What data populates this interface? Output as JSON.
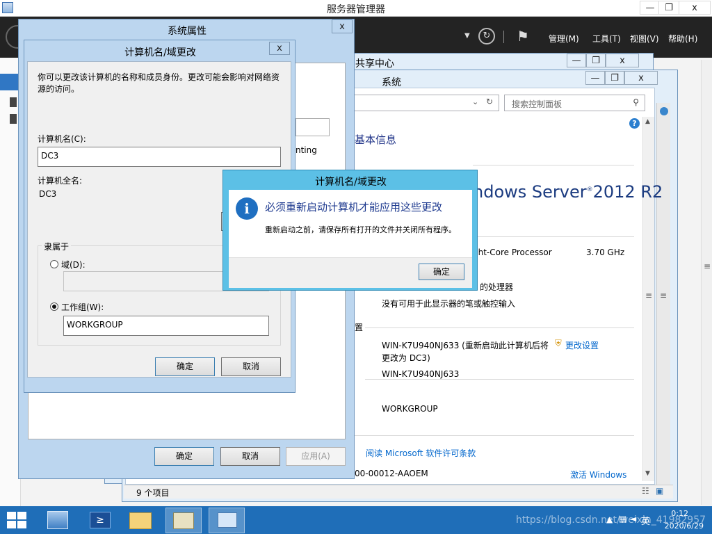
{
  "server_manager": {
    "title": "服务器管理器",
    "menus": [
      "管理(M)",
      "工具(T)",
      "视图(V)",
      "帮助(H)"
    ]
  },
  "window_controls": {
    "minimize": "—",
    "restore": "❐",
    "close": "x"
  },
  "network_center": {
    "title": "共享中心"
  },
  "system_window": {
    "title": "系统",
    "search_placeholder": "搜索控制面板",
    "heading": "基本信息",
    "os_brand": "ndows Server",
    "os_version": "2012 R2",
    "processor": "ght-Core Processor",
    "processor_speed": "3.70 GHz",
    "system_type": "的处理器",
    "pen_touch": "没有可用于此显示器的笔或触控输入",
    "section_label": "置",
    "computer_name": "WIN-K7U940NJ633 (重新启动此计算机后将",
    "computer_name_cont": "更改为 DC3)",
    "change_settings": "更改设置",
    "full_name": "WIN-K7U940NJ633",
    "workgroup": "WORKGROUP",
    "license_link": "阅读 Microsoft 软件许可条款",
    "product_id": "00-00012-AAOEM",
    "activate": "激活 Windows",
    "behind_text": "nting"
  },
  "status_bar": {
    "items": "9 个项目"
  },
  "system_properties": {
    "title": "系统属性",
    "ok": "确定",
    "cancel": "取消",
    "apply": "应用(A)"
  },
  "computer_name_dialog": {
    "title": "计算机名/域更改",
    "description": "你可以更改该计算机的名称和成员身份。更改可能会影响对网络资源的访问。",
    "name_label": "计算机名(C):",
    "name_value": "DC3",
    "full_name_label": "计算机全名:",
    "full_name_value": "DC3",
    "member_of": "隶属于",
    "domain_label": "域(D):",
    "domain_value": "",
    "workgroup_label": "工作组(W):",
    "workgroup_value": "WORKGROUP",
    "ok": "确定",
    "cancel": "取消"
  },
  "restart_dialog": {
    "title": "计算机名/域更改",
    "main_instruction": "必须重新启动计算机才能应用这些更改",
    "content": "重新启动之前，请保存所有打开的文件并关闭所有程序。",
    "ok": "确定"
  },
  "taskbar": {
    "time": "0:12",
    "date": "2020/6/29",
    "ime": "英",
    "watermark": "https://blog.csdn.net/weixin_41982957"
  },
  "colors": {
    "taskbar": "#1f6eb8",
    "dialog_frame": "#bcd6ef",
    "info_dialog_frame": "#5cc0e6",
    "link": "#0066cc"
  }
}
